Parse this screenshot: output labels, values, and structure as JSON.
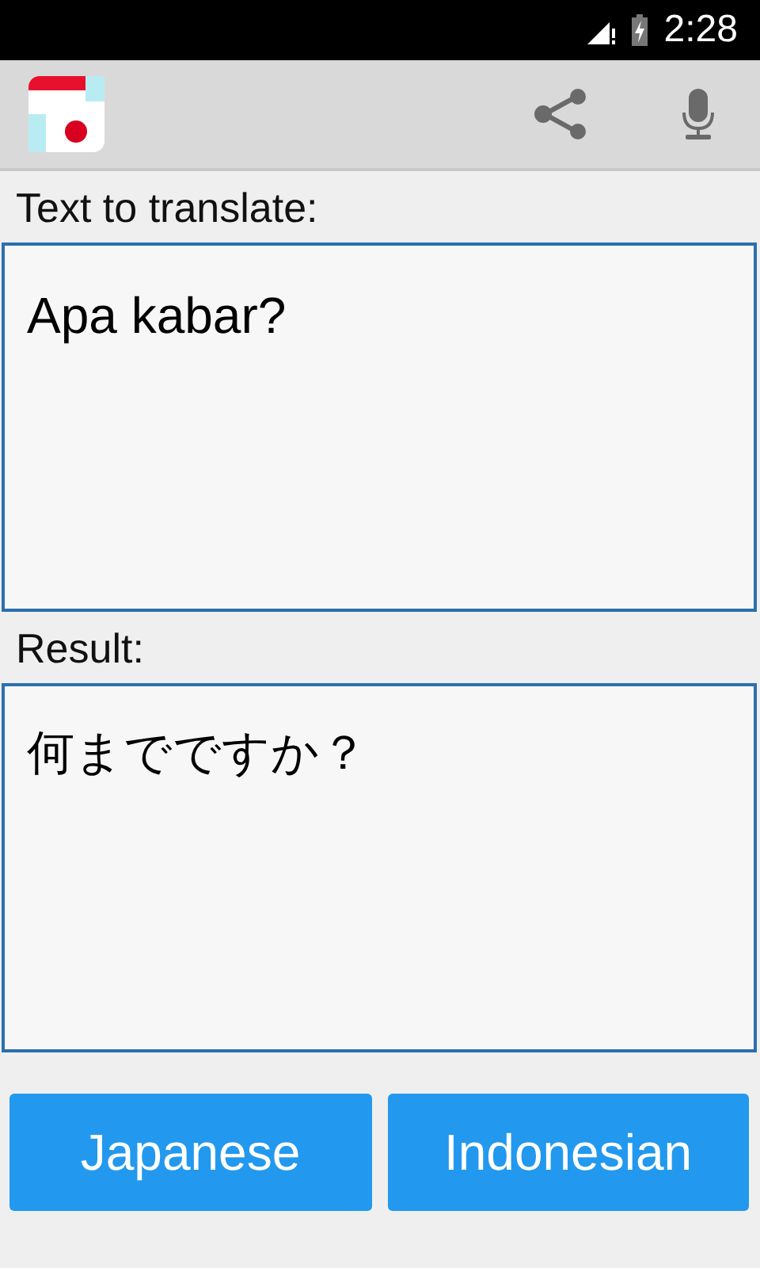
{
  "status_bar": {
    "time": "2:28"
  },
  "input": {
    "label": "Text to translate:",
    "value": "Apa kabar?"
  },
  "result": {
    "label": "Result:",
    "value": "何までですか？"
  },
  "buttons": [
    "Japanese",
    "Indonesian"
  ]
}
